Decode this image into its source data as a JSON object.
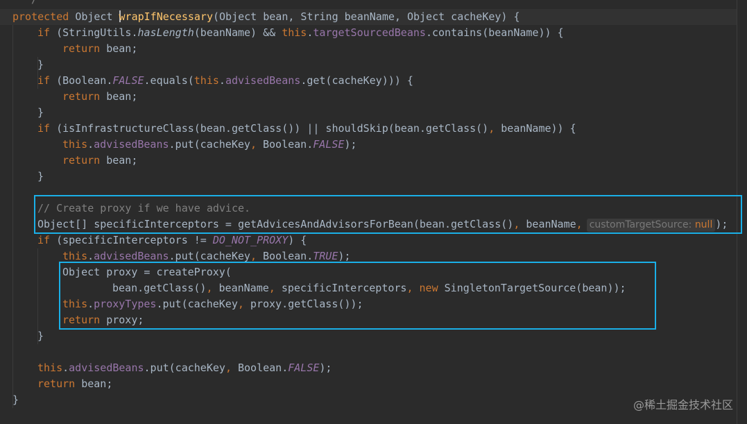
{
  "editor": {
    "language": "java",
    "theme": "darcula",
    "colors": {
      "background": "#2b2b2b",
      "keyword": "#cc7832",
      "field": "#9876aa",
      "method_declaration": "#ffc66d",
      "comment": "#808080",
      "default_text": "#a9b7c6",
      "highlight_border": "#1ab0e8"
    },
    "partial_top_line": "*/",
    "lines": [
      {
        "modifier": "protected",
        "type": "Object",
        "method": "wrapIfNecessary",
        "params": "(Object bean, String beanName, Object cacheKey) {"
      },
      {
        "kw_if": "if",
        "a": " (StringUtils.",
        "b": "hasLength",
        "c": "(beanName) && ",
        "d": "this",
        "e": ".",
        "f": "targetSourcedBeans",
        "g": ".contains(beanName)) {"
      },
      {
        "kw": "return",
        "rest": " bean;"
      },
      {
        "text": "}"
      },
      {
        "kw_if": "if",
        "a": " (Boolean.",
        "b": "FALSE",
        "c": ".equals(",
        "d": "this",
        "e": ".",
        "f": "advisedBeans",
        "g": ".get(cacheKey))) {"
      },
      {
        "kw": "return",
        "rest": " bean;"
      },
      {
        "text": "}"
      },
      {
        "kw_if": "if",
        "a": " (isInfrastructureClass(bean.getClass()) || shouldSkip(bean.getClass()",
        "b": ",",
        "c": " beanName)) {"
      },
      {
        "this": "this",
        "dot": ".",
        "field": "advisedBeans",
        "a": ".put(cacheKey",
        "comma": ",",
        "b": " Boolean.",
        "const": "FALSE",
        "c": ");"
      },
      {
        "kw": "return",
        "rest": " bean;"
      },
      {
        "text": "}"
      },
      {
        "comment": "// Create proxy if we have advice."
      },
      {
        "a": "Object[] specificInterceptors = getAdvicesAndAdvisorsForBean(bean.getClass()",
        "comma1": ",",
        "b": " beanName",
        "comma2": ",",
        "hint_name": "customTargetSource:",
        "hint_value": "null",
        "c": ");"
      },
      {
        "kw_if": "if",
        "a": " (specificInterceptors != ",
        "const": "DO_NOT_PROXY",
        "b": ") {"
      },
      {
        "this": "this",
        "dot": ".",
        "field": "advisedBeans",
        "a": ".put(cacheKey",
        "comma": ",",
        "b": " Boolean.",
        "const": "TRUE",
        "c": ");"
      },
      {
        "text": "Object proxy = createProxy("
      },
      {
        "a": "bean.getClass()",
        "c1": ",",
        "b": " beanName",
        "c2": ",",
        "c": " specificInterceptors",
        "c3": ",",
        "new": "new",
        "d": " SingletonTargetSource(bean));"
      },
      {
        "this": "this",
        "dot": ".",
        "field": "proxyTypes",
        "a": ".put(cacheKey",
        "comma": ",",
        "b": " proxy.getClass());"
      },
      {
        "kw": "return",
        "rest": " proxy;"
      },
      {
        "text": "}"
      },
      {
        "this": "this",
        "dot": ".",
        "field": "advisedBeans",
        "a": ".put(cacheKey",
        "comma": ",",
        "b": " Boolean.",
        "const": "FALSE",
        "c": ");"
      },
      {
        "kw": "return",
        "rest": " bean;"
      },
      {
        "text": "}"
      }
    ]
  },
  "watermark": "@稀土掘金技术社区"
}
